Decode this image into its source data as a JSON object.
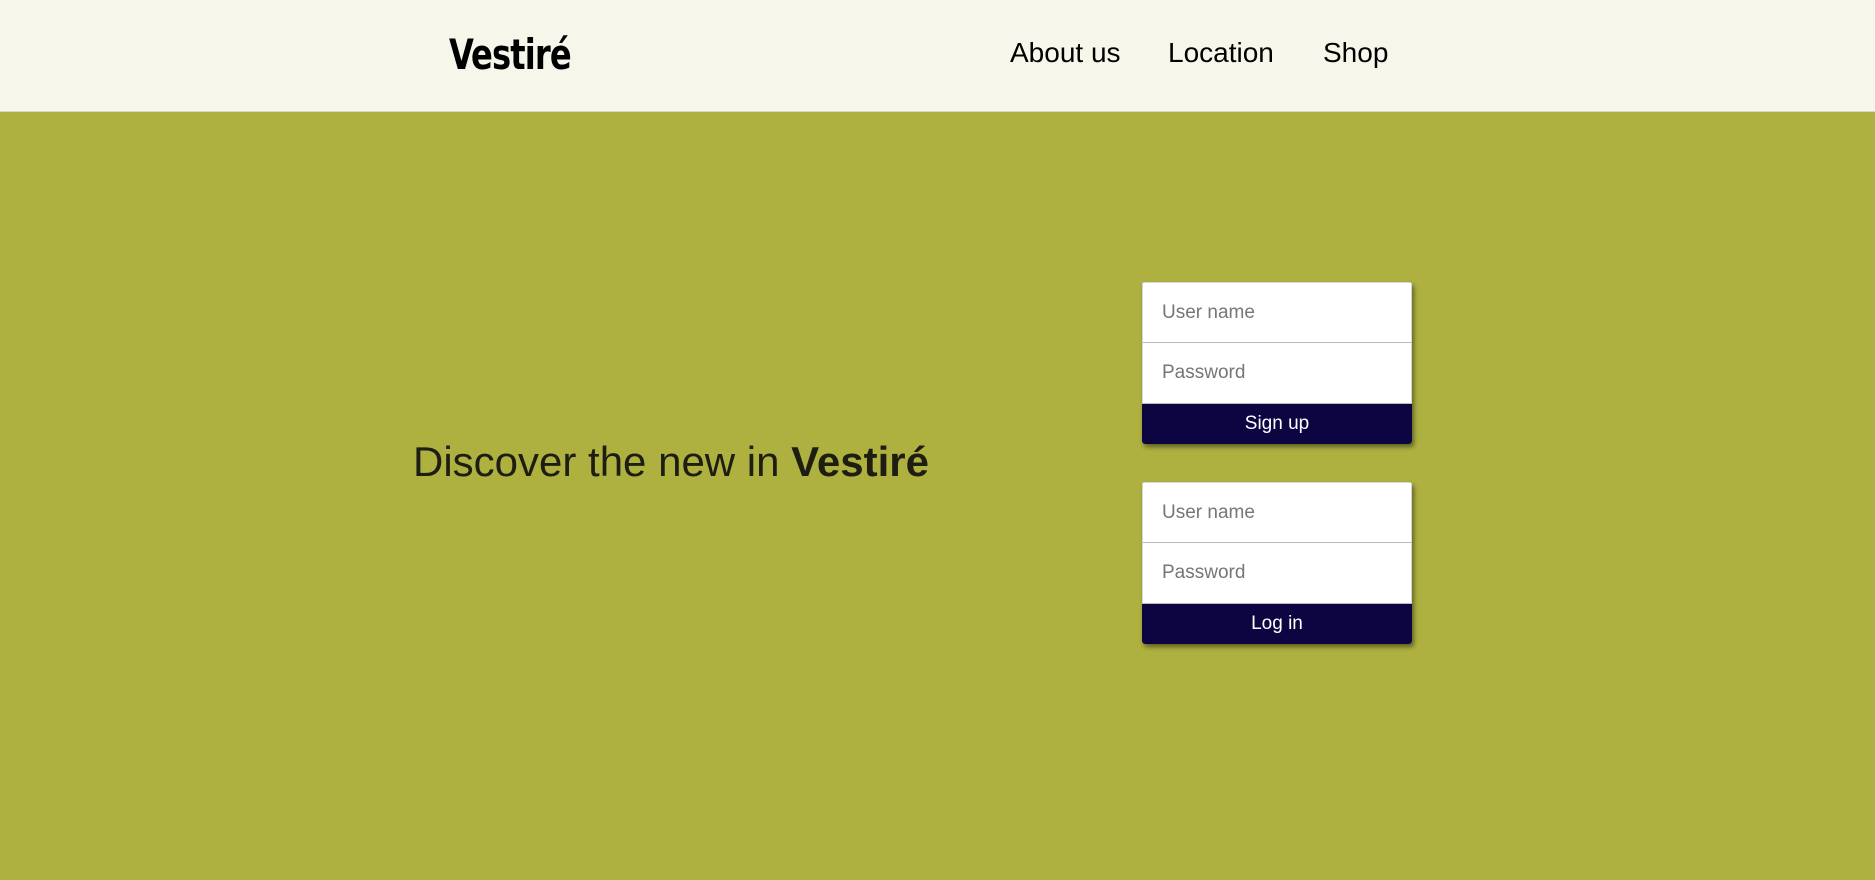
{
  "header": {
    "logo": "Vestiré",
    "nav": [
      {
        "label": "About us"
      },
      {
        "label": "Location"
      },
      {
        "label": "Shop"
      }
    ]
  },
  "hero": {
    "text_prefix": "Discover the new in ",
    "text_brand": "Vestiré"
  },
  "signup_form": {
    "username_placeholder": "User name",
    "password_placeholder": "Password",
    "button_label": "Sign up"
  },
  "login_form": {
    "username_placeholder": "User name",
    "password_placeholder": "Password",
    "button_label": "Log in"
  },
  "colors": {
    "header_bg": "#f7f6ea",
    "page_bg": "#aeb140",
    "button_bg": "#0d0542",
    "button_text": "#ffffff"
  }
}
